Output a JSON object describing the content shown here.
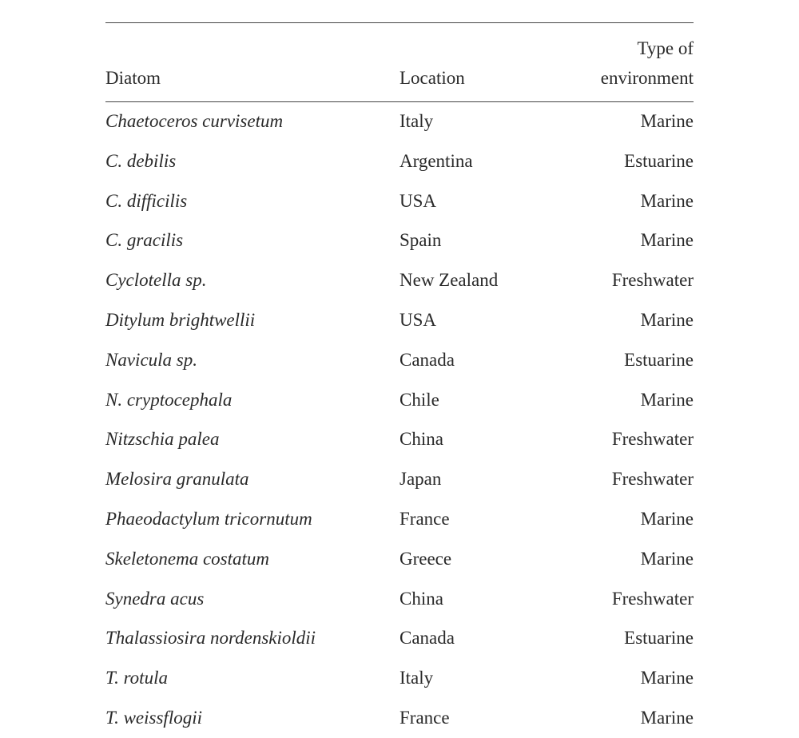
{
  "table": {
    "headers": {
      "diatom": "Diatom",
      "location": "Location",
      "environment_l1": "Type of",
      "environment_l2": "environment"
    },
    "rows": [
      {
        "diatom": "Chaetoceros curvisetum",
        "location": "Italy",
        "environment": "Marine"
      },
      {
        "diatom": "C. debilis",
        "location": "Argentina",
        "environment": "Estuarine"
      },
      {
        "diatom": "C. difficilis",
        "location": "USA",
        "environment": "Marine"
      },
      {
        "diatom": "C. gracilis",
        "location": "Spain",
        "environment": "Marine"
      },
      {
        "diatom": "Cyclotella sp.",
        "location": "New Zealand",
        "environment": "Freshwater"
      },
      {
        "diatom": "Ditylum brightwellii",
        "location": "USA",
        "environment": "Marine"
      },
      {
        "diatom": "Navicula sp.",
        "location": "Canada",
        "environment": "Estuarine"
      },
      {
        "diatom": "N. cryptocephala",
        "location": "Chile",
        "environment": "Marine"
      },
      {
        "diatom": "Nitzschia palea",
        "location": "China",
        "environment": "Freshwater"
      },
      {
        "diatom": "Melosira granulata",
        "location": "Japan",
        "environment": "Freshwater"
      },
      {
        "diatom": "Phaeodactylum tricornutum",
        "location": "France",
        "environment": "Marine"
      },
      {
        "diatom": "Skeletonema costatum",
        "location": "Greece",
        "environment": "Marine"
      },
      {
        "diatom": "Synedra acus",
        "location": "China",
        "environment": "Freshwater"
      },
      {
        "diatom": "Thalassiosira nordenskioldii",
        "location": "Canada",
        "environment": "Estuarine"
      },
      {
        "diatom": "T. rotula",
        "location": "Italy",
        "environment": "Marine"
      },
      {
        "diatom": "T. weissflogii",
        "location": "France",
        "environment": "Marine"
      }
    ]
  }
}
